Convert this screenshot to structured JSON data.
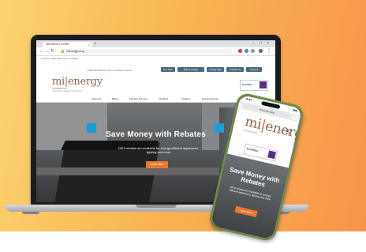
{
  "colors": {
    "background_gradient": [
      "#fbd36f",
      "#f9b553",
      "#f7944a"
    ],
    "accent_orange": "#e85c1e",
    "button_orange": "#e8782f",
    "phone_green": "#6f8a4d",
    "header_button": "#4a6a7a"
  },
  "browser": {
    "tab_title": "MIENERGY CORP",
    "tab_close": "×",
    "new_tab": "+",
    "window_controls": [
      "–",
      "□",
      "×"
    ],
    "url": "mienergy.coop",
    "lock_icon": "lock-icon",
    "bookmarks": "Account Login   Pay Online   Outages   ..."
  },
  "site": {
    "logo_main": "mi",
    "logo_j": "|",
    "logo_rest": "energy",
    "logo_tagline": "COOPERATIVE",
    "logo_partners": "A Touchstone Energy® Cooperative",
    "top_links": "1-800-428-5350   Pay Online   Locations   Careers",
    "header_buttons": [
      "Pay Now",
      "Report Outage",
      "Outage Map",
      "Contact Us",
      "Careers"
    ],
    "partner_name": "EverBlue",
    "menu": [
      "About Us",
      "Billing",
      "Member Services",
      "Rebates",
      "Outages",
      "Energy Savings"
    ]
  },
  "hero": {
    "title": "Save Money with Rebates",
    "subtitle": "2024 rebates are available for energy-efficient appliances, lighting and more",
    "button": "Learn More"
  },
  "phone": {
    "time": "9:41",
    "signal": "▮▮▮",
    "url": "mienergy.coop",
    "menu_icon": "☰",
    "hero_title": "Save Money with Rebates",
    "hero_subtitle": "2024 rebates are available for energy-efficient appliances, lighting and more",
    "hero_button": "Learn More"
  }
}
